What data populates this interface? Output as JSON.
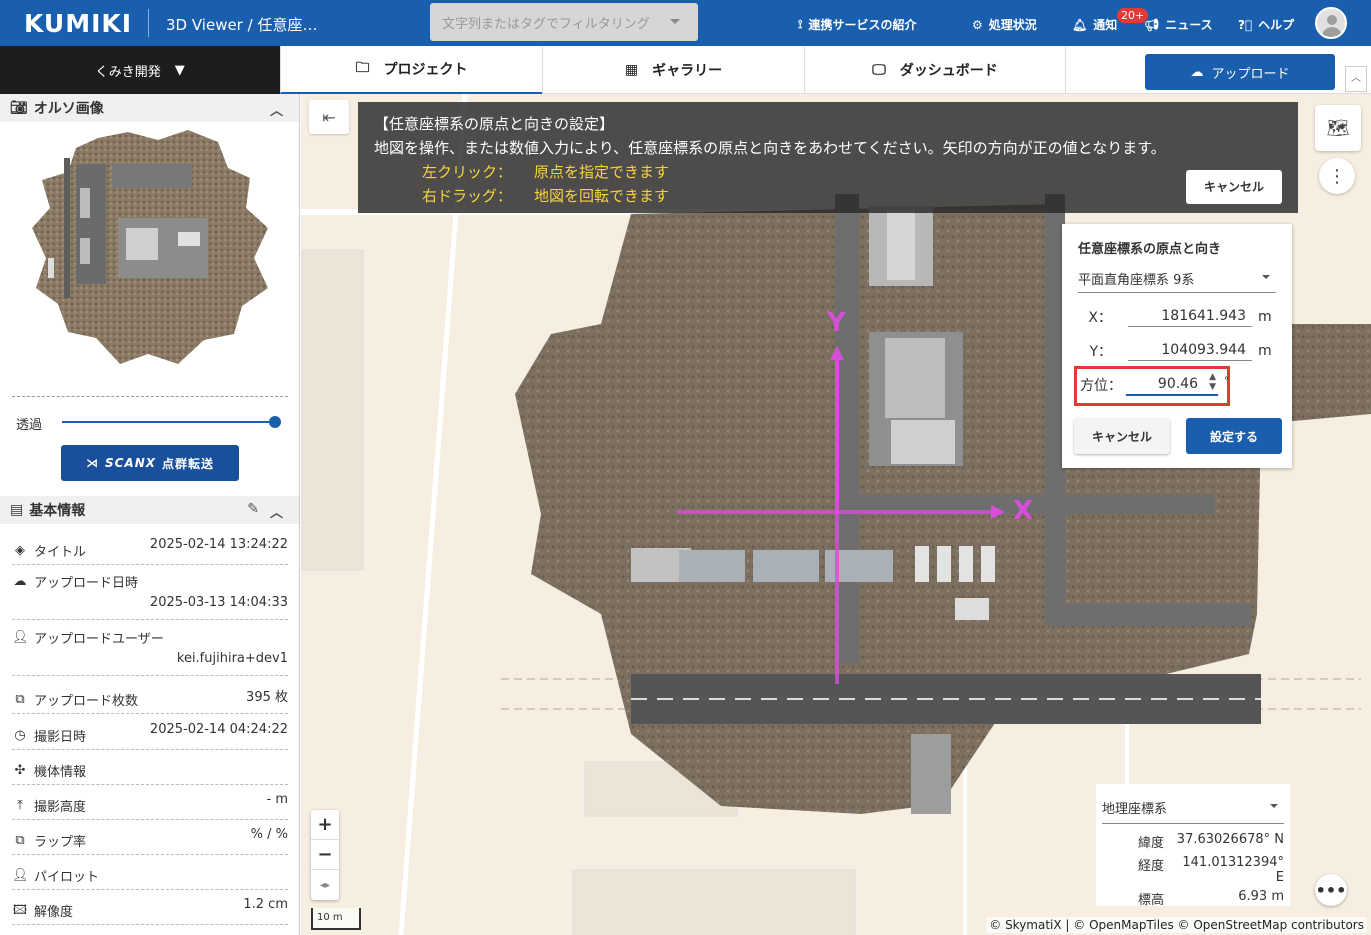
{
  "header": {
    "logo": "KUMIKI",
    "title": "3D Viewer / 任意座…",
    "filter_placeholder": "文字列またはタグでフィルタリング",
    "nav": {
      "services": "連携サービスの紹介",
      "status": "処理状況",
      "notify": "通知",
      "notify_badge": "20+",
      "news": "ニュース",
      "help": "ヘルプ"
    }
  },
  "subbar": {
    "org": "くみき開発",
    "tabs": [
      "プロジェクト",
      "ギャラリー",
      "ダッシュボード"
    ],
    "upload": "アップロード"
  },
  "sidebar": {
    "ortho_title": "オルソ画像",
    "opacity_label": "透過",
    "opacity_value": 1.0,
    "scanx_logo": "SCANX",
    "scanx_label": "点群転送",
    "info_title": "基本情報",
    "info": [
      {
        "key": "タイトル",
        "value": "2025-02-14 13:24:22",
        "icon": "layers-icon"
      },
      {
        "key": "アップロード日時",
        "value": "2025-03-13 14:04:33",
        "icon": "upload-cloud-icon"
      },
      {
        "key": "アップロードユーザー",
        "value": "kei.fujihira+dev1",
        "icon": "user-icon"
      },
      {
        "key": "アップロード枚数",
        "value": "395 枚",
        "icon": "images-icon"
      },
      {
        "key": "撮影日時",
        "value": "2025-02-14 04:24:22",
        "icon": "clock-icon"
      },
      {
        "key": "機体情報",
        "value": "",
        "icon": "drone-icon"
      },
      {
        "key": "撮影高度",
        "value": "- m",
        "icon": "altitude-icon"
      },
      {
        "key": "ラップ率",
        "value": "% / %",
        "icon": "overlap-icon"
      },
      {
        "key": "パイロット",
        "value": "",
        "icon": "user-icon"
      },
      {
        "key": "解像度",
        "value": "1.2 cm",
        "icon": "image-icon"
      }
    ]
  },
  "banner": {
    "title": "【任意座標系の原点と向きの設定】",
    "desc": "地図を操作、または数値入力により、任意座標系の原点と向きをあわせてください。矢印の方向が正の値となります。",
    "left_key": "左クリック：",
    "left_desc": "原点を指定できます",
    "right_key": "右ドラッグ：",
    "right_desc": "地図を回転できます",
    "cancel": "キャンセル"
  },
  "panel": {
    "title": "任意座標系の原点と向き",
    "system": "平面直角座標系 9系",
    "x_label": "X：",
    "x_value": "181641.943",
    "x_unit": "m",
    "y_label": "Y：",
    "y_value": "104093.944",
    "y_unit": "m",
    "dir_label": "方位：",
    "dir_value": "90.46",
    "dir_unit": "°",
    "cancel": "キャンセル",
    "submit": "設定する"
  },
  "axes": {
    "x": "X",
    "y": "Y"
  },
  "geo": {
    "system": "地理座標系",
    "lat_label": "緯度",
    "lat": "37.63026678° N",
    "lon_label": "経度",
    "lon": "141.01312394° E",
    "alt_label": "標高",
    "alt": "6.93 m"
  },
  "scale": "10 m",
  "attribution": "© SkymatiX | © OpenMapTiles © OpenStreetMap contributors",
  "colors": {
    "brand": "#1a5fae",
    "axis": "#d64fd6",
    "highlight": "#e53935"
  }
}
